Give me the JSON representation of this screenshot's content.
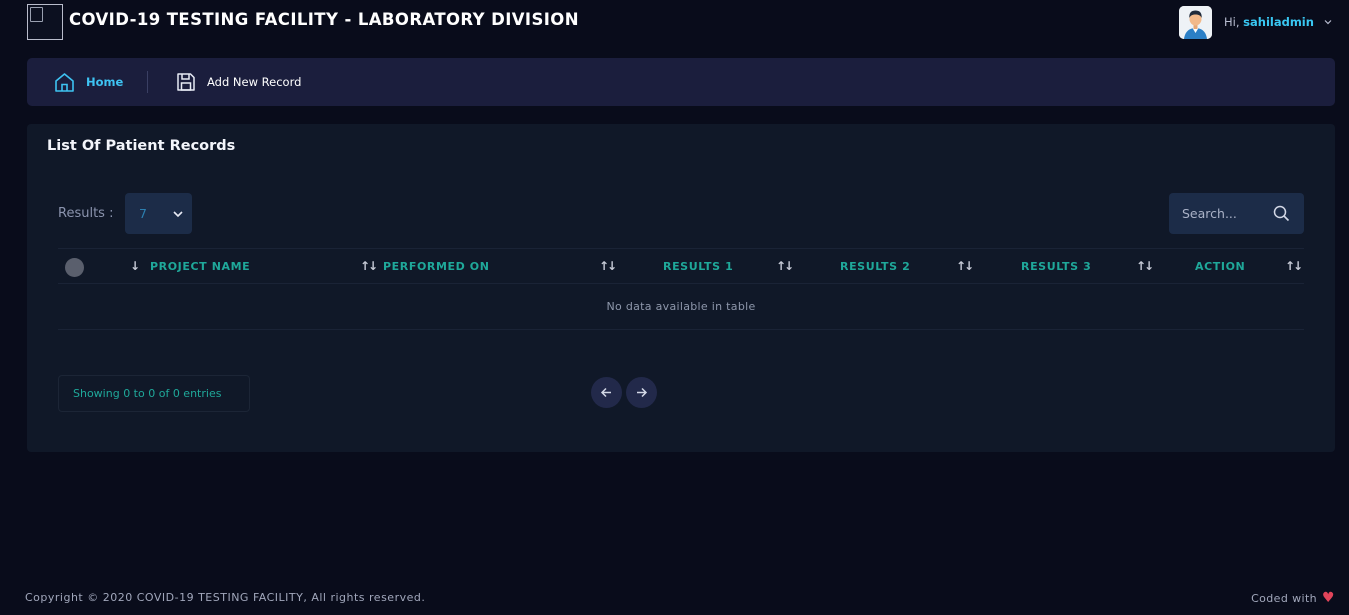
{
  "header": {
    "title": "COVID-19 TESTING FACILITY - LABORATORY DIVISION",
    "greeting": "Hi,",
    "username": "sahiladmin"
  },
  "nav": {
    "home_label": "Home",
    "add_label": "Add New Record"
  },
  "card": {
    "title": "List Of Patient Records",
    "results_label": "Results :",
    "results_value": "7",
    "search_placeholder": "Search...",
    "columns": [
      {
        "label": "PROJECT NAME",
        "sort": "↓"
      },
      {
        "label": "PERFORMED ON",
        "sort": "↑↓"
      },
      {
        "label": "RESULTS 1",
        "sort": "↑↓"
      },
      {
        "label": "RESULTS 2",
        "sort": "↑↓"
      },
      {
        "label": "RESULTS 3",
        "sort": "↑↓"
      },
      {
        "label": "ACTION",
        "sort": "↑↓"
      }
    ],
    "last_sort": "↑↓",
    "empty_text": "No data available in table",
    "info_text": "Showing 0 to 0 of 0 entries"
  },
  "footer": {
    "copyright": "Copyright © 2020 COVID-19 TESTING FACILITY, All rights reserved.",
    "coded_with": "Coded with",
    "heart": "♥"
  },
  "colors": {
    "accent": "#3ec3f2",
    "teal": "#1fa89a",
    "background": "#090c1b",
    "card": "#101828",
    "navbar": "#1b1e3d"
  }
}
